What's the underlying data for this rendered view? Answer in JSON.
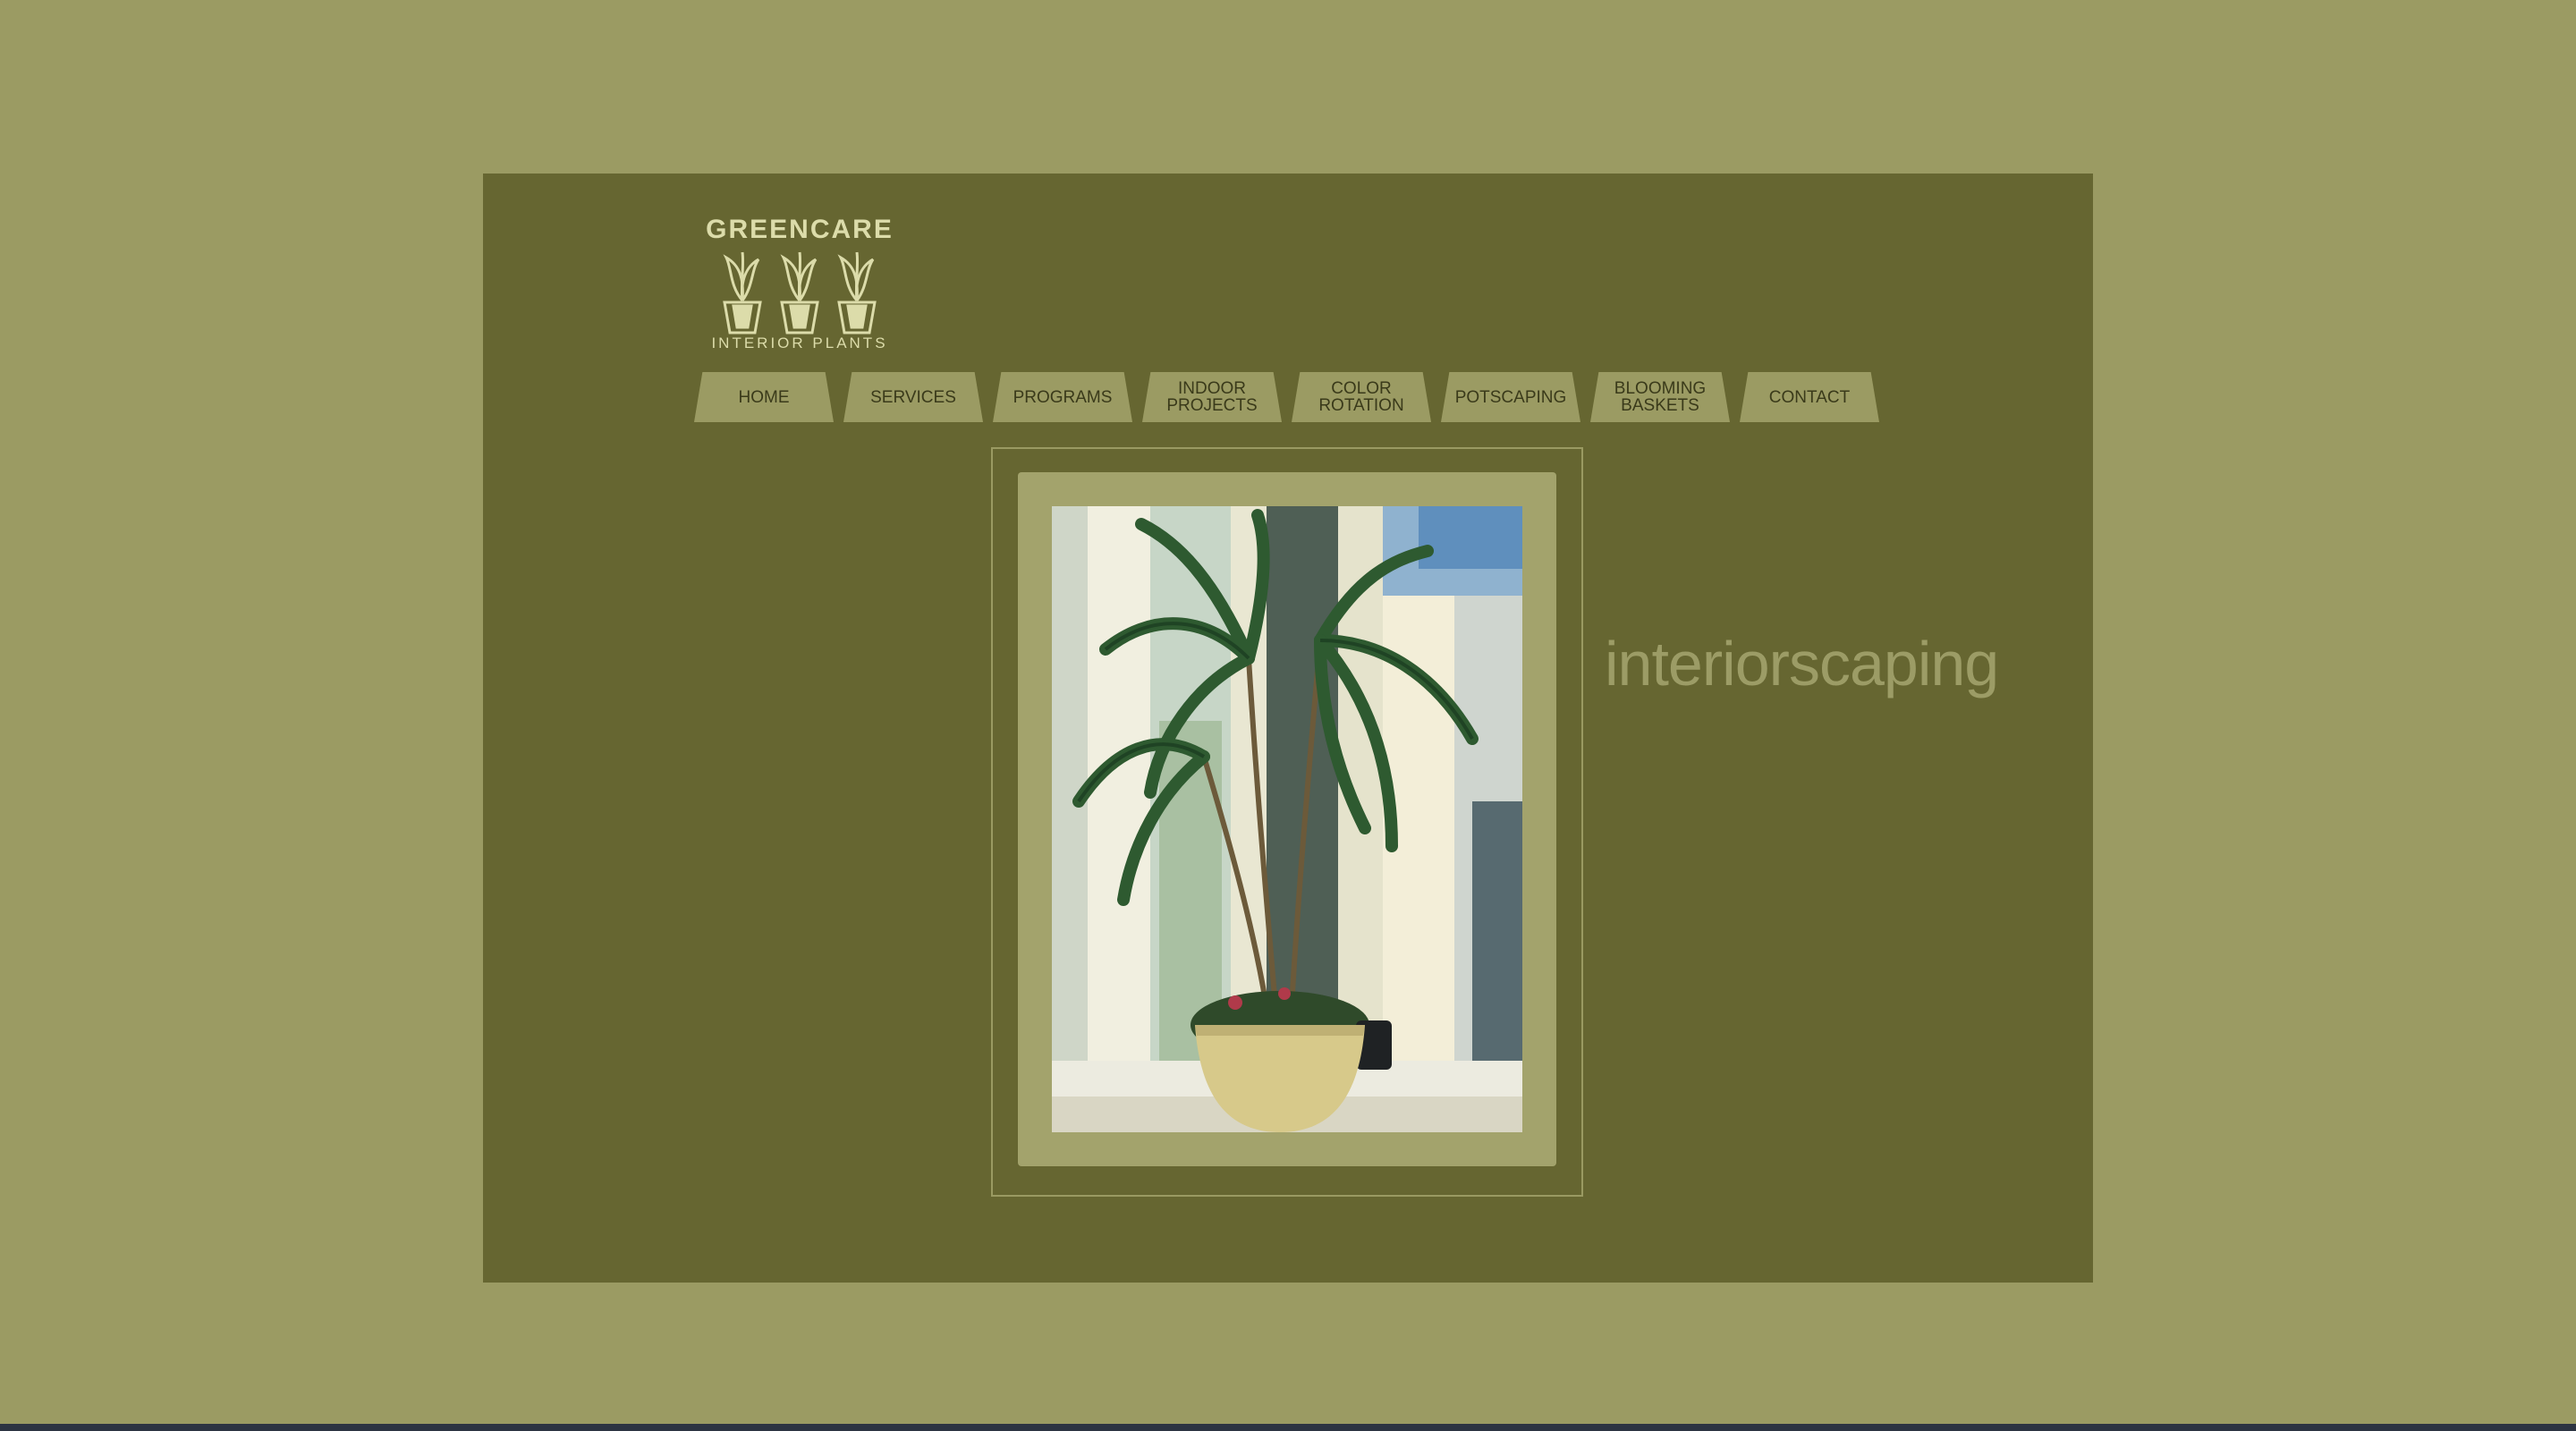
{
  "brand": {
    "name": "GREENCARE",
    "subtitle": "INTERIOR PLANTS"
  },
  "nav": [
    {
      "lines": [
        "HOME"
      ]
    },
    {
      "lines": [
        "SERVICES"
      ]
    },
    {
      "lines": [
        "PROGRAMS"
      ]
    },
    {
      "lines": [
        "INDOOR",
        "PROJECTS"
      ]
    },
    {
      "lines": [
        "COLOR",
        "ROTATION"
      ]
    },
    {
      "lines": [
        "POTSCAPING"
      ]
    },
    {
      "lines": [
        "BLOOMING",
        "BASKETS"
      ]
    },
    {
      "lines": [
        "CONTACT"
      ]
    }
  ],
  "hero": {
    "image_alt": "palm tree in pot in bright lobby",
    "tagline": "interiorscaping"
  },
  "colors": {
    "page_background": "#9b9b63",
    "panel_background": "#666631",
    "tab_background": "#9b9b63",
    "logo_color": "#dcdcaa",
    "tagline_color": "#9c9c66"
  }
}
